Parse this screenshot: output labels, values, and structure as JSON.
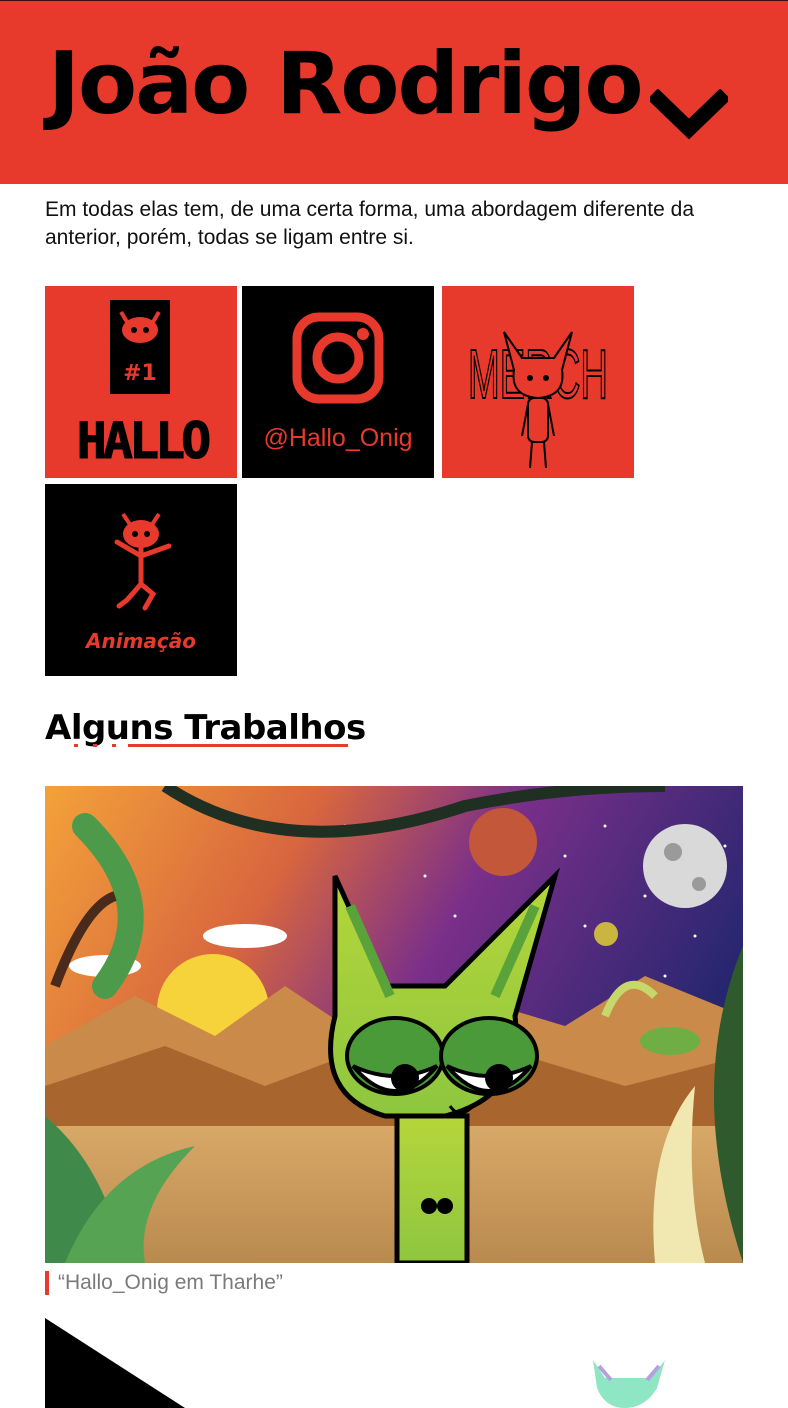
{
  "header": {
    "title": "João Rodrigo",
    "menu_icon": "chevron-down-icon",
    "background": "#e8392d"
  },
  "intro": {
    "text": "Em todas elas tem, de uma certa forma, uma abordagem diferente da anterior, porém, todas se ligam entre si."
  },
  "tiles": [
    {
      "name": "hallo",
      "badge": "#1",
      "label": "HALLO",
      "background": "#e8392d"
    },
    {
      "name": "instagram",
      "label": "@Hallo_Onig",
      "icon": "instagram-icon",
      "background": "#000000"
    },
    {
      "name": "merch",
      "label": "MERCH",
      "background": "#e8392d"
    },
    {
      "name": "animacao",
      "label": "Animação",
      "background": "#000000"
    }
  ],
  "section": {
    "title": "Alguns Trabalhos"
  },
  "gallery": {
    "caption": "“Hallo_Onig em Tharhe”"
  },
  "colors": {
    "accent": "#e8392d",
    "character": "#9acd32"
  }
}
